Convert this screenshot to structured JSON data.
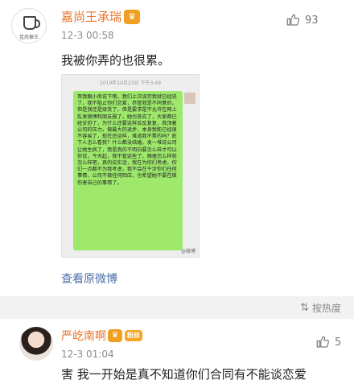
{
  "comments": [
    {
      "avatar_text": "佳尚振王",
      "name": "嘉尚王承瑞",
      "badge_icon": "crown-icon",
      "time": "12-3 00:58",
      "likes": "93",
      "text": "我被你弄的也很累。",
      "screenshot": {
        "date": "2019年10月23日 下午3:49",
        "message": "哥我跟小南说下哦，我们上次谈完我就已经说了，我不阻止你们恋爱，尽管我是不同意的，但是我还是接受了，但是要求是不允许在网上乱发微博和朋友圈了，她也答应了，大家都已经妥协了，为什么还要这样反反复复，我顶着公司的压力，做最大的退步，本身我能已经很不容易了，现在还这样，难道我不累的吗？底下人怎么看我？什么都没结婚，发一堆说公司让她生病了，我是真的不明白要怎么样才可以你说，今天起，我不管这些了，随便怎么样就怎么样吧，真的说实话，我在为你们考虑，你们一点都不为我考虑，我不会在干涉你们任何事情，公司不做任何回应，也希望她不要在做伤害自己的事情了。",
        "watermark": "@微博"
      },
      "view_link": "查看原微博"
    },
    {
      "name": "严屹南啊",
      "badge_icon": "crown-icon",
      "tag": "粉丝",
      "time": "12-3 01:04",
      "likes": "5",
      "text": "害 我一开始是真不知道你们合同有不能谈恋爱"
    }
  ],
  "sort_label": "按热度",
  "colors": {
    "name_orange": "#e8742c",
    "link_blue": "#4a6ea8",
    "bubble_green": "#9ee86c",
    "badge_gold": "#f0a020"
  }
}
